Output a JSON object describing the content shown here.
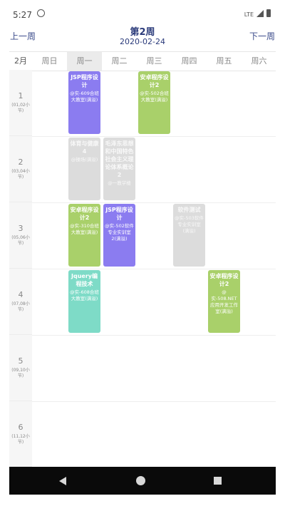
{
  "status": {
    "time": "5:27",
    "network": "LTE"
  },
  "header": {
    "prev_label": "上一周",
    "next_label": "下一周",
    "week_title": "第2周",
    "date": "2020-02-24"
  },
  "month": "2月",
  "days": [
    "周日",
    "周一",
    "周二",
    "周三",
    "周四",
    "周五",
    "周六"
  ],
  "active_day": "周一",
  "slots": [
    {
      "num": "1",
      "range": "(01,02小节)"
    },
    {
      "num": "2",
      "range": "(03,04小节)"
    },
    {
      "num": "3",
      "range": "(05,06小节)"
    },
    {
      "num": "4",
      "range": "(07,08小节)"
    },
    {
      "num": "5",
      "range": "(09,10小节)"
    },
    {
      "num": "6",
      "range": "(11,12小节)"
    }
  ],
  "courses": [
    {
      "name": "JSP程序设计",
      "room": "@实-609合班大教室(满溢)",
      "color": "#8b7cf0"
    },
    {
      "name": "安卓程序设计2",
      "room": "@实-502合班大教室(满溢)",
      "color": "#a9d06a"
    },
    {
      "name": "体育与健康4",
      "room": "@操场(满溢)",
      "color": "#dcdcdc"
    },
    {
      "name": "毛泽东思想和中国特色社会主义理论体系概论2",
      "room": "@一教学楼",
      "color": "#dcdcdc"
    },
    {
      "name": "安卓程序设计2",
      "room": "@实-310合班大教室(满溢)",
      "color": "#a9d06a"
    },
    {
      "name": "JSP程序设计",
      "room": "@实-502软件专业实训室2(满溢)",
      "color": "#8b7cf0"
    },
    {
      "name": "软件测试",
      "room": "@实-503软件专业实训室(满溢)",
      "color": "#dcdcdc"
    },
    {
      "name": "Jquery编程技术",
      "room": "@实-608合班大教室(满溢)",
      "color": "#7edbc7"
    },
    {
      "name": "安卓程序设计2",
      "room": "@实-508.NET应用开发工作室(满溢)",
      "color": "#a9d06a"
    }
  ]
}
